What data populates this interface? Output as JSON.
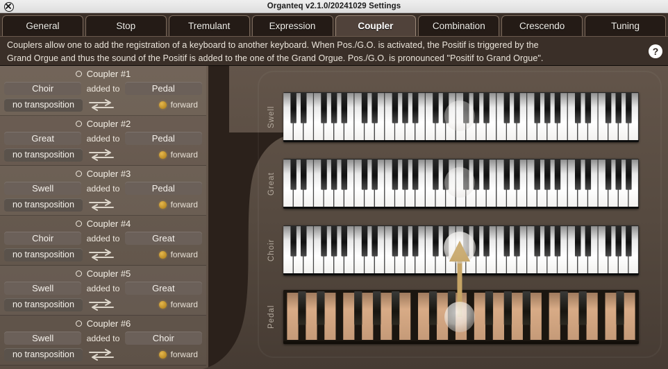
{
  "window": {
    "title": "Organteq v2.1.0/20241029 Settings",
    "close_icon": "close-circle-icon"
  },
  "tabs": [
    {
      "label": "General",
      "active": false
    },
    {
      "label": "Stop",
      "active": false
    },
    {
      "label": "Tremulant",
      "active": false
    },
    {
      "label": "Expression",
      "active": false
    },
    {
      "label": "Coupler",
      "active": true
    },
    {
      "label": "Combination",
      "active": false
    },
    {
      "label": "Crescendo",
      "active": false
    },
    {
      "label": "Tuning",
      "active": false
    }
  ],
  "description": {
    "line1": "Couplers allow one to add the registration of a keyboard to another keyboard. When Pos./G.O. is activated, the Positif is triggered by the",
    "line2": "Grand Orgue and thus the sound of the Positif is added to the one of the Grand Orgue. Pos./G.O. is pronounced \"Positif to Grand Orgue\".",
    "help_label": "?",
    "help_icon": "question-mark-icon"
  },
  "couplers": {
    "added_to_label": "added to",
    "swap_icon": "bidirectional-arrows-icon",
    "items": [
      {
        "title": "Coupler #1",
        "source": "Choir",
        "target": "Pedal",
        "transposition": "no transposition",
        "direction": "forward",
        "enabled": false
      },
      {
        "title": "Coupler #2",
        "source": "Great",
        "target": "Pedal",
        "transposition": "no transposition",
        "direction": "forward",
        "enabled": false
      },
      {
        "title": "Coupler #3",
        "source": "Swell",
        "target": "Pedal",
        "transposition": "no transposition",
        "direction": "forward",
        "enabled": false
      },
      {
        "title": "Coupler #4",
        "source": "Choir",
        "target": "Great",
        "transposition": "no transposition",
        "direction": "forward",
        "enabled": false
      },
      {
        "title": "Coupler #5",
        "source": "Swell",
        "target": "Great",
        "transposition": "no transposition",
        "direction": "forward",
        "enabled": false
      },
      {
        "title": "Coupler #6",
        "source": "Swell",
        "target": "Choir",
        "transposition": "no transposition",
        "direction": "forward",
        "enabled": false
      }
    ]
  },
  "keyboards": [
    {
      "label": "Swell",
      "type": "manual"
    },
    {
      "label": "Great",
      "type": "manual"
    },
    {
      "label": "Choir",
      "type": "manual"
    },
    {
      "label": "Pedal",
      "type": "pedalboard"
    }
  ],
  "connection": {
    "from_keyboard": "Pedal",
    "to_keyboard": "Choir",
    "arrow_icon": "up-arrow-icon"
  },
  "colors": {
    "background": "#2b211b",
    "panel": "#5a4c42",
    "accent_led": "#c9962e",
    "arrow": "#c6a465",
    "tab_active": "#50423a",
    "text": "#f2efe9"
  }
}
